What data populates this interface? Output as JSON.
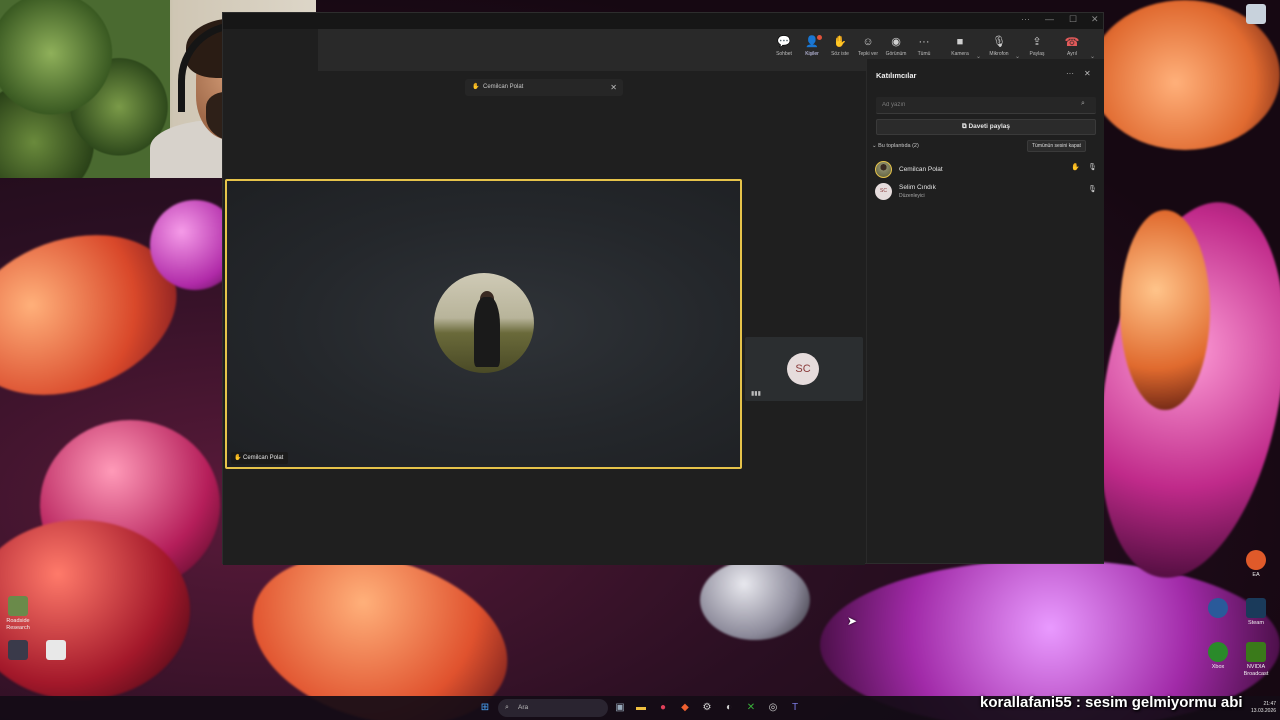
{
  "teams": {
    "toolbar": {
      "buttons": [
        {
          "label": "Sohbet",
          "icon": "chat-icon"
        },
        {
          "label": "Kişiler",
          "icon": "people-icon"
        },
        {
          "label": "Söz iste",
          "icon": "raise-hand-icon"
        },
        {
          "label": "Tepki ver",
          "icon": "react-icon"
        },
        {
          "label": "Görünüm",
          "icon": "view-icon"
        },
        {
          "label": "Tümü",
          "icon": "more-icon"
        },
        {
          "label": "Kamera",
          "icon": "camera-icon"
        },
        {
          "label": "Mikrofon",
          "icon": "mic-icon"
        },
        {
          "label": "Paylaş",
          "icon": "share-icon"
        }
      ],
      "leave_label": "Ayrıl"
    },
    "stage": {
      "pinned_chip": "Cemilcan Polat",
      "main_tile_name": "Cemilcan Polat",
      "side_tile_initials": "SC"
    },
    "panel": {
      "title": "Katılımcılar",
      "search_placeholder": "Ad yazın",
      "invite_label": "Daveti paylaş",
      "section_label": "Bu toplantıda (2)",
      "mute_all_label": "Tümünün sesini kapat",
      "participants": [
        {
          "name": "Cemilcan Polat",
          "role": "",
          "initials": "",
          "hand_raised": true
        },
        {
          "name": "Selim Cındık",
          "role": "Düzenleyici",
          "initials": "SC",
          "hand_raised": false
        }
      ]
    }
  },
  "desktop": {
    "icons": [
      {
        "label": "Roadside Research"
      },
      {
        "label": "EA",
        "right": true
      },
      {
        "label": "Steam"
      },
      {
        "label": "NVIDIA Broadcast"
      },
      {
        "label": "Xbox"
      }
    ]
  },
  "taskbar": {
    "search_placeholder": "Ara",
    "time": "21:47",
    "date": "13.03.2026"
  },
  "overlay": {
    "chat_text": "korallafani55 : sesim gelmiyormu abi"
  },
  "colors": {
    "accent_highlight": "#e6c34a",
    "leave_red": "#e35a5a",
    "raise_hand": "#f0c84a"
  }
}
